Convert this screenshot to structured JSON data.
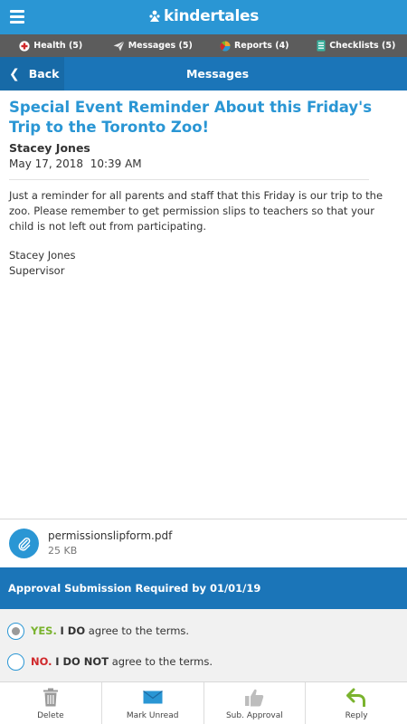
{
  "app": {
    "brand": "kindertales",
    "colors": {
      "primary": "#2a96d4",
      "dark_blue": "#1b75b8",
      "tab_bar": "#5c5c5c",
      "yes": "#7ab32e",
      "no": "#d0282b"
    }
  },
  "tabs": [
    {
      "label": "Health (5)",
      "icon": "health-icon"
    },
    {
      "label": "Messages (5)",
      "icon": "paper-plane-icon"
    },
    {
      "label": "Reports (4)",
      "icon": "pie-chart-icon"
    },
    {
      "label": "Checklists (5)",
      "icon": "checklist-icon"
    }
  ],
  "nav": {
    "back_label": "Back",
    "title": "Messages"
  },
  "message": {
    "title": "Special Event Reminder About this Friday's Trip to the Toronto Zoo!",
    "sender": "Stacey Jones",
    "date": "May 17, 2018  10:39 AM",
    "body": "Just a reminder for all parents and staff that this Friday is our trip to the zoo. Please remember to get permission slips to teachers so that your child is not left out from participating.",
    "signature_name": "Stacey Jones",
    "signature_title": "Supervisor"
  },
  "attachment": {
    "filename": "permissionslipform.pdf",
    "size": "25 KB",
    "icon": "paperclip-icon"
  },
  "approval": {
    "header": "Approval Submission Required by 01/01/19",
    "yes_word": "YES.",
    "yes_strong": "I DO",
    "yes_rest": "agree to the terms.",
    "no_word": "NO.",
    "no_strong": "I DO NOT",
    "no_rest": "agree to the terms.",
    "selected": "yes"
  },
  "toolbar": [
    {
      "label": "Delete",
      "icon": "trash-icon"
    },
    {
      "label": "Mark Unread",
      "icon": "envelope-icon"
    },
    {
      "label": "Sub. Approval",
      "icon": "thumbs-up-icon"
    },
    {
      "label": "Reply",
      "icon": "reply-icon"
    }
  ]
}
